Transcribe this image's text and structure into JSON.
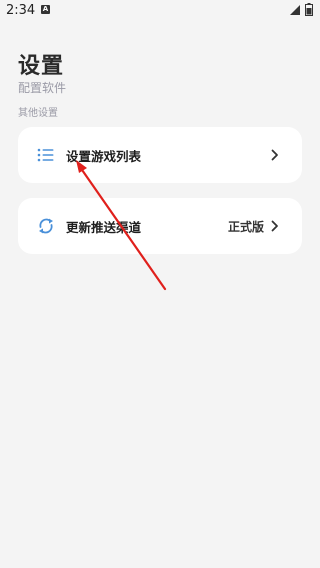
{
  "status_bar": {
    "time": "2:34",
    "notification_glyph": "A",
    "icons": [
      "signal-icon",
      "battery-icon"
    ]
  },
  "header": {
    "title": "设置",
    "subtitle": "配置软件"
  },
  "section": {
    "label": "其他设置"
  },
  "items": [
    {
      "icon": "list-icon",
      "label": "设置游戏列表",
      "value": ""
    },
    {
      "icon": "sync-icon",
      "label": "更新推送渠道",
      "value": "正式版"
    }
  ],
  "colors": {
    "background": "#f4f4f4",
    "card": "#ffffff",
    "accent_icon": "#4a90d9",
    "muted_text": "#9a9aa6",
    "annotation_arrow": "#e0201c"
  }
}
